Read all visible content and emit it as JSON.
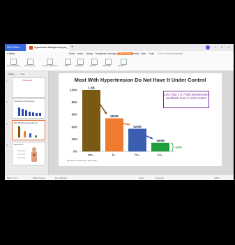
{
  "titlebar": {
    "app_name": "WPS Office",
    "doc_tab": "Hypertension Management.pptx",
    "close": "×",
    "new_tab": "+",
    "controls": "─ □ ×"
  },
  "menubar": {
    "items": [
      "≡ Menu",
      "Home",
      "Insert",
      "Design",
      "Transitions",
      "Animation",
      "Slide Show",
      "Review",
      "View",
      "Tools"
    ],
    "active_index": 6,
    "search": "Click to find commands"
  },
  "toolbar": {
    "tools": [
      "From Beginning",
      "From Current",
      "Custom Slideshow",
      "Play",
      "Rehearse",
      "Record",
      "Hide Slide",
      "Settings"
    ]
  },
  "panel": {
    "tabs": [
      "Outline",
      "Slides"
    ],
    "selected_tab": 1,
    "thumbnails": [
      {
        "num": "1",
        "title": "Hypertension"
      },
      {
        "num": "2",
        "title": "Prevalence of Hypertension"
      },
      {
        "num": "3",
        "title": "Most With Hypertension Do Not..."
      },
      {
        "num": "4",
        "title": "Risk Factors"
      }
    ],
    "selected_thumb": 2,
    "add_slide": "+"
  },
  "slide": {
    "title": "Most With Hypertension Do Not Have It Under Control",
    "callout": "Less than 1 in 7 with hypertension worldwide have it under control",
    "source": "Data Source: Hypertension, WHO, 2023",
    "bracket_label": "~14%"
  },
  "chart_data": {
    "type": "bar",
    "categories": [
      "Wo...",
      "D...",
      "Tre...",
      "Co..."
    ],
    "values": [
      100,
      54,
      37,
      14
    ],
    "data_labels": [
      "1.3B",
      "650M",
      "520M",
      "190M"
    ],
    "colors": [
      "#7a5a12",
      "#ef7c2e",
      "#3a5fb0",
      "#1f9e3c"
    ],
    "yticks": [
      "0%",
      "20%",
      "40%",
      "60%",
      "80%",
      "100%"
    ],
    "ylim": [
      0,
      100
    ],
    "grid": false
  },
  "statusbar": {
    "left": [
      "Slide 3 / 14",
      "Office Theme",
      "Font Missing"
    ],
    "right": [
      "Notes",
      "Comment",
      "100%"
    ]
  }
}
